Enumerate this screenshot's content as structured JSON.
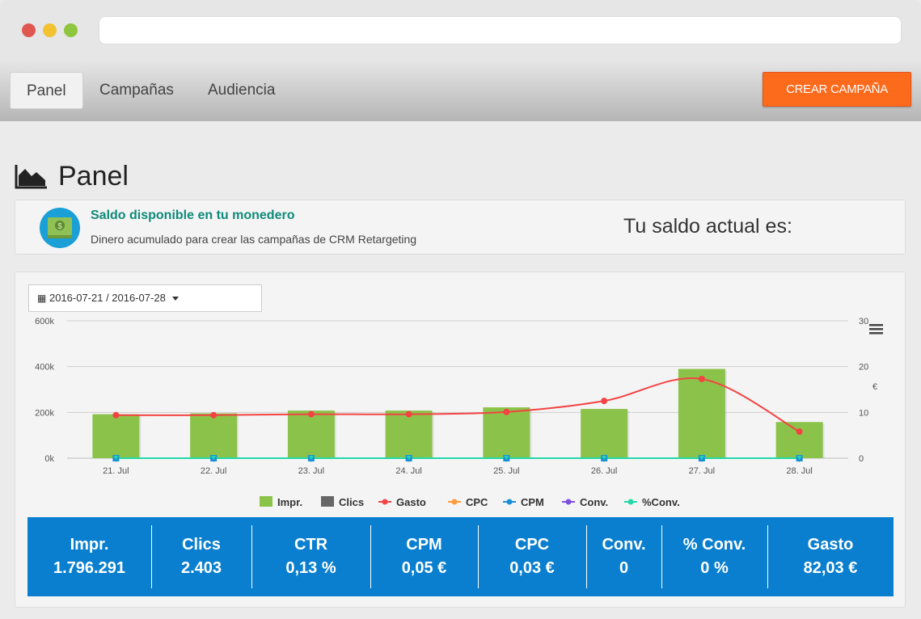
{
  "nav": {
    "tabs": [
      {
        "label": "Panel",
        "active": true
      },
      {
        "label": "Campañas",
        "active": false
      },
      {
        "label": "Audiencia",
        "active": false
      }
    ],
    "create_label": "CREAR CAMPAÑA"
  },
  "page_title": "Panel",
  "wallet": {
    "title": "Saldo disponible en tu monedero",
    "subtitle": "Dinero acumulado para crear las campañas de CRM Retargeting",
    "balance_label": "Tu saldo actual es:"
  },
  "date_range": "2016-07-21 / 2016-07-28",
  "chart_data": {
    "type": "bar",
    "categories": [
      "21. Jul",
      "22. Jul",
      "23. Jul",
      "24. Jul",
      "25. Jul",
      "26. Jul",
      "27. Jul",
      "28. Jul"
    ],
    "series": [
      {
        "name": "Impr.",
        "type": "bar",
        "axis": "left",
        "color": "#8bc34a",
        "values": [
          192000,
          196000,
          208000,
          208000,
          222000,
          215000,
          390000,
          158000
        ]
      },
      {
        "name": "Clics",
        "type": "bar",
        "axis": "left",
        "color": "#666666",
        "values": [
          300,
          300,
          310,
          310,
          330,
          320,
          340,
          250
        ]
      },
      {
        "name": "Gasto",
        "type": "line",
        "axis": "right",
        "color": "#f44343",
        "values": [
          9.4,
          9.4,
          9.6,
          9.6,
          10.1,
          12.5,
          17.3,
          5.8
        ]
      },
      {
        "name": "CPC",
        "type": "line",
        "axis": "right",
        "color": "#ff9a3c",
        "values": [
          0.03,
          0.03,
          0.03,
          0.03,
          0.03,
          0.04,
          0.05,
          0.02
        ]
      },
      {
        "name": "CPM",
        "type": "line",
        "axis": "right",
        "color": "#1a8fd8",
        "values": [
          0.05,
          0.05,
          0.05,
          0.05,
          0.05,
          0.06,
          0.04,
          0.04
        ]
      },
      {
        "name": "Conv.",
        "type": "line",
        "axis": "right",
        "color": "#7b4fe0",
        "values": [
          0,
          0,
          0,
          0,
          0,
          0,
          0,
          0
        ]
      },
      {
        "name": "%Conv.",
        "type": "line",
        "axis": "right",
        "color": "#22d8a8",
        "values": [
          0,
          0,
          0,
          0,
          0,
          0,
          0,
          0
        ]
      }
    ],
    "y_left": {
      "ticks": [
        "0k",
        "200k",
        "400k",
        "600k"
      ],
      "range": [
        0,
        600000
      ]
    },
    "y_right": {
      "ticks": [
        "0",
        "10",
        "20",
        "30"
      ],
      "range": [
        0,
        30
      ],
      "label": "€"
    },
    "grid": true,
    "legend_position": "bottom-center"
  },
  "stats": [
    {
      "label": "Impr.",
      "value": "1.796.291"
    },
    {
      "label": "Clics",
      "value": "2.403"
    },
    {
      "label": "CTR",
      "value": "0,13 %"
    },
    {
      "label": "CPM",
      "value": "0,05 €"
    },
    {
      "label": "CPC",
      "value": "0,03 €"
    },
    {
      "label": "Conv.",
      "value": "0"
    },
    {
      "label": "% Conv.",
      "value": "0 %"
    },
    {
      "label": "Gasto",
      "value": "82,03 €"
    }
  ]
}
